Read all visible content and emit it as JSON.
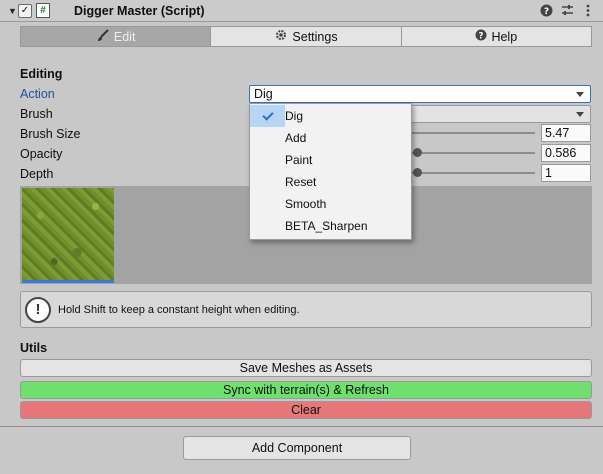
{
  "component": {
    "title": "Digger Master (Script)",
    "enabled": true,
    "icon": "script-icon",
    "header_icons": [
      "help-icon",
      "presets-icon",
      "overflow-menu-icon"
    ]
  },
  "tabs": [
    {
      "label": "Edit",
      "icon": "brush-icon",
      "active": true
    },
    {
      "label": "Settings",
      "icon": "gear-icon",
      "active": false
    },
    {
      "label": "Help",
      "icon": "help-circle-icon",
      "active": false
    }
  ],
  "editing": {
    "section_label": "Editing",
    "action_label": "Action",
    "action_value": "Dig",
    "brush_label": "Brush",
    "brush_size_label": "Brush Size",
    "brush_size_value": "5.47",
    "opacity_label": "Opacity",
    "opacity_value": "0.586",
    "depth_label": "Depth",
    "depth_value": "1"
  },
  "help_text": "Hold Shift to keep a constant height when editing.",
  "utils": {
    "section_label": "Utils",
    "save_meshes_label": "Save Meshes as Assets",
    "sync_label": "Sync with terrain(s) & Refresh",
    "clear_label": "Clear"
  },
  "add_component_label": "Add Component",
  "action_menu": {
    "items": [
      "Dig",
      "Add",
      "Paint",
      "Reset",
      "Smooth",
      "BETA_Sharpen"
    ],
    "selected": "Dig"
  },
  "colors": {
    "sync_button": "#6ee06e",
    "clear_button": "#e6787a",
    "selection_blue": "#3a79d6"
  }
}
